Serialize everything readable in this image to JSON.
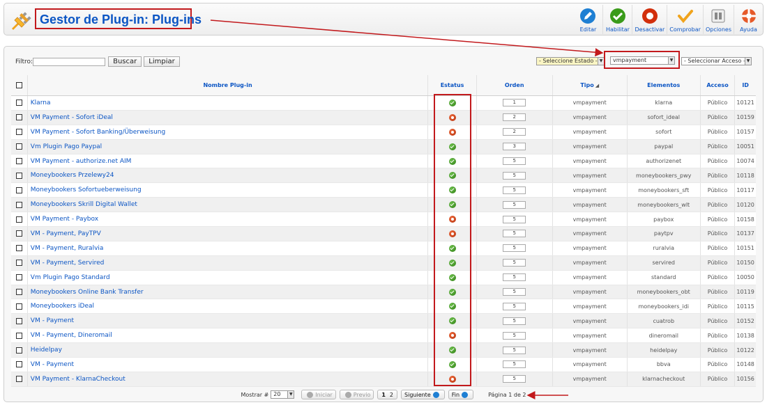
{
  "header": {
    "title": "Gestor de Plug-in: Plug-ins",
    "toolbar": [
      {
        "name": "edit-button",
        "icon": "edit-icon",
        "label": "Editar",
        "color": "#1e7fd3"
      },
      {
        "name": "enable-button",
        "icon": "check-icon",
        "label": "Habilitar",
        "color": "#3a9b1a"
      },
      {
        "name": "disable-button",
        "icon": "stop-icon",
        "label": "Desactivar",
        "color": "#d22f0c"
      },
      {
        "name": "check-button",
        "icon": "checkmark-icon",
        "label": "Comprobar",
        "color": "#f0a31c"
      },
      {
        "name": "options-button",
        "icon": "options-icon",
        "label": "Opciones",
        "color": "#888888"
      },
      {
        "name": "help-button",
        "icon": "lifebuoy-icon",
        "label": "Ayuda",
        "color": "#e65a2a"
      }
    ]
  },
  "filter": {
    "label": "Filtro:",
    "value": "",
    "search_label": "Buscar",
    "clear_label": "Limpiar",
    "state_select": "- Seleccione Estado -",
    "type_select": "vmpayment",
    "access_select": "- Seleccionar Acceso -"
  },
  "table": {
    "headers": {
      "name": "Nombre Plug-in",
      "status": "Estatus",
      "order": "Orden",
      "type": "Tipo",
      "elements": "Elementos",
      "access": "Acceso",
      "id": "ID"
    },
    "rows": [
      {
        "name": "Klarna",
        "enabled": true,
        "order": "1",
        "type": "vmpayment",
        "element": "klarna",
        "access": "Público",
        "id": "10121"
      },
      {
        "name": "VM Payment - Sofort iDeal",
        "enabled": false,
        "order": "2",
        "type": "vmpayment",
        "element": "sofort_ideal",
        "access": "Público",
        "id": "10159"
      },
      {
        "name": "VM Payment - Sofort Banking/Überweisung",
        "enabled": false,
        "order": "2",
        "type": "vmpayment",
        "element": "sofort",
        "access": "Público",
        "id": "10157"
      },
      {
        "name": "Vm Plugin Pago Paypal",
        "enabled": true,
        "order": "3",
        "type": "vmpayment",
        "element": "paypal",
        "access": "Público",
        "id": "10051"
      },
      {
        "name": "VM Payment - authorize.net AIM",
        "enabled": true,
        "order": "5",
        "type": "vmpayment",
        "element": "authorizenet",
        "access": "Público",
        "id": "10074"
      },
      {
        "name": "Moneybookers Przelewy24",
        "enabled": true,
        "order": "5",
        "type": "vmpayment",
        "element": "moneybookers_pwy",
        "access": "Público",
        "id": "10118"
      },
      {
        "name": "Moneybookers Sofortueberweisung",
        "enabled": true,
        "order": "5",
        "type": "vmpayment",
        "element": "moneybookers_sft",
        "access": "Público",
        "id": "10117"
      },
      {
        "name": "Moneybookers Skrill Digital Wallet",
        "enabled": true,
        "order": "5",
        "type": "vmpayment",
        "element": "moneybookers_wlt",
        "access": "Público",
        "id": "10120"
      },
      {
        "name": "VM Payment - Paybox",
        "enabled": false,
        "order": "5",
        "type": "vmpayment",
        "element": "paybox",
        "access": "Público",
        "id": "10158"
      },
      {
        "name": "VM - Payment, PayTPV",
        "enabled": false,
        "order": "5",
        "type": "vmpayment",
        "element": "paytpv",
        "access": "Público",
        "id": "10137"
      },
      {
        "name": "VM - Payment, Ruralvia",
        "enabled": true,
        "order": "5",
        "type": "vmpayment",
        "element": "ruralvia",
        "access": "Público",
        "id": "10151"
      },
      {
        "name": "VM - Payment, Servired",
        "enabled": true,
        "order": "5",
        "type": "vmpayment",
        "element": "servired",
        "access": "Público",
        "id": "10150"
      },
      {
        "name": "Vm Plugin Pago Standard",
        "enabled": true,
        "order": "5",
        "type": "vmpayment",
        "element": "standard",
        "access": "Público",
        "id": "10050"
      },
      {
        "name": "Moneybookers Online Bank Transfer",
        "enabled": true,
        "order": "5",
        "type": "vmpayment",
        "element": "moneybookers_obt",
        "access": "Público",
        "id": "10119"
      },
      {
        "name": "Moneybookers iDeal",
        "enabled": true,
        "order": "5",
        "type": "vmpayment",
        "element": "moneybookers_idi",
        "access": "Público",
        "id": "10115"
      },
      {
        "name": "VM - Payment",
        "enabled": true,
        "order": "5",
        "type": "vmpayment",
        "element": "cuatrob",
        "access": "Público",
        "id": "10152"
      },
      {
        "name": "VM - Payment, Dineromail",
        "enabled": false,
        "order": "5",
        "type": "vmpayment",
        "element": "dineromail",
        "access": "Público",
        "id": "10138"
      },
      {
        "name": "Heidelpay",
        "enabled": true,
        "order": "5",
        "type": "vmpayment",
        "element": "heidelpay",
        "access": "Público",
        "id": "10122"
      },
      {
        "name": "VM - Payment",
        "enabled": true,
        "order": "5",
        "type": "vmpayment",
        "element": "bbva",
        "access": "Público",
        "id": "10148"
      },
      {
        "name": "VM Payment - KlarnaCheckout",
        "enabled": false,
        "order": "5",
        "type": "vmpayment",
        "element": "klarnacheckout",
        "access": "Público",
        "id": "10156"
      }
    ]
  },
  "pagination": {
    "limit_label": "Mostrar #",
    "limit_value": "20",
    "start_label": "Iniciar",
    "prev_label": "Previo",
    "pages": [
      "1",
      "2"
    ],
    "current_page": "1",
    "next_label": "Siguiente",
    "end_label": "Fin",
    "page_info": "Página 1 de 2"
  },
  "colors": {
    "accent": "#0b55c4",
    "annotation": "#c2191c",
    "enabled": "#3a9b1a",
    "disabled": "#d22f0c"
  }
}
